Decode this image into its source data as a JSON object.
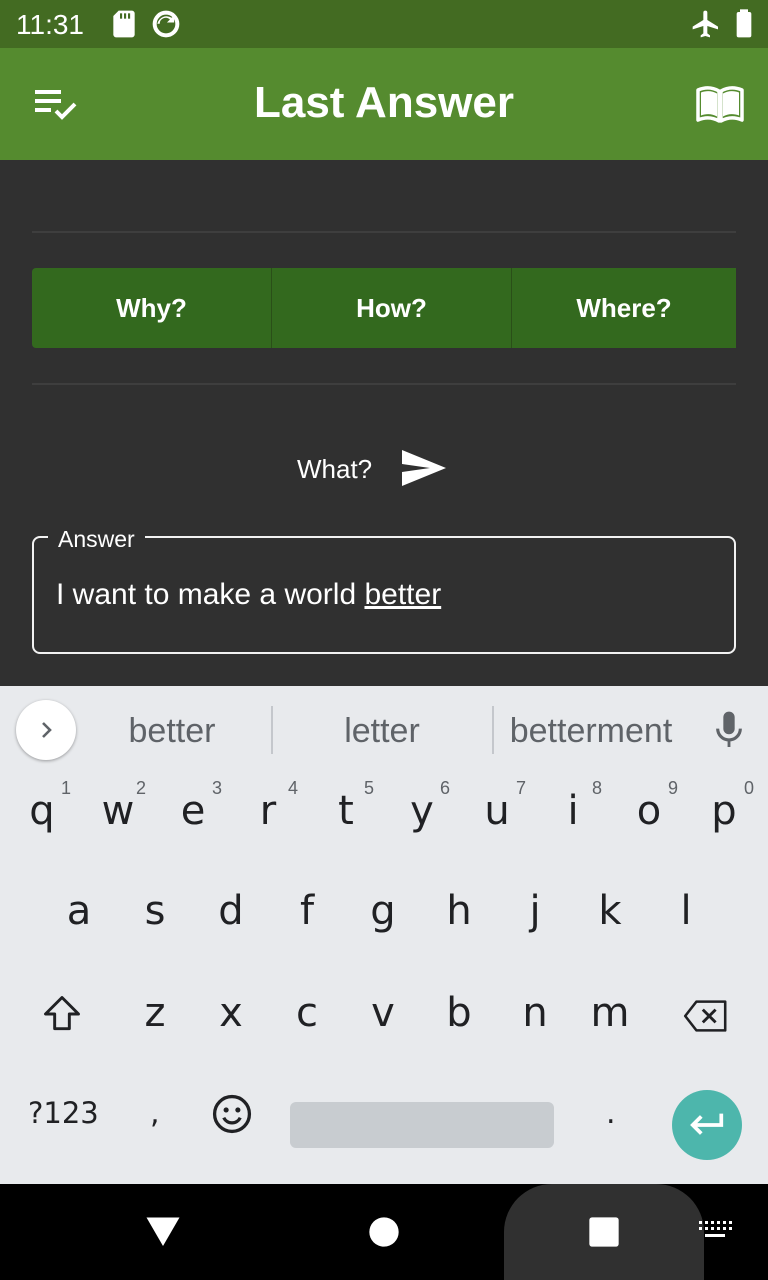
{
  "status_bar": {
    "time": "11:31",
    "icons": [
      "sd-card-icon",
      "sync-icon",
      "airplane-mode-icon",
      "battery-icon"
    ]
  },
  "app_bar": {
    "title": "Last Answer",
    "left_icon": "playlist-check-icon",
    "right_icon": "book-open-icon"
  },
  "question_buttons": [
    {
      "label": "Why?"
    },
    {
      "label": "How?"
    },
    {
      "label": "Where?"
    }
  ],
  "question": {
    "text": "What?",
    "send_icon": "send-icon"
  },
  "answer": {
    "label": "Answer",
    "value_prefix": "I want to make a world ",
    "value_underlined": "better"
  },
  "keyboard": {
    "suggestions": [
      "better",
      "letter",
      "betterment"
    ],
    "row1": [
      "q",
      "w",
      "e",
      "r",
      "t",
      "y",
      "u",
      "i",
      "o",
      "p"
    ],
    "row1_hints": [
      "1",
      "2",
      "3",
      "4",
      "5",
      "6",
      "7",
      "8",
      "9",
      "0"
    ],
    "row2": [
      "a",
      "s",
      "d",
      "f",
      "g",
      "h",
      "j",
      "k",
      "l"
    ],
    "row3": [
      "z",
      "x",
      "c",
      "v",
      "b",
      "n",
      "m"
    ],
    "symbols_key": "?123",
    "comma_key": ",",
    "period_key": ".",
    "colors": {
      "background": "#E8EAED",
      "enter": "#4DB6AC",
      "space": "#C8CCD0"
    }
  },
  "colors": {
    "status_bar": "#436B22",
    "app_bar": "#558B2F",
    "button": "#33691E",
    "background": "#303030"
  }
}
